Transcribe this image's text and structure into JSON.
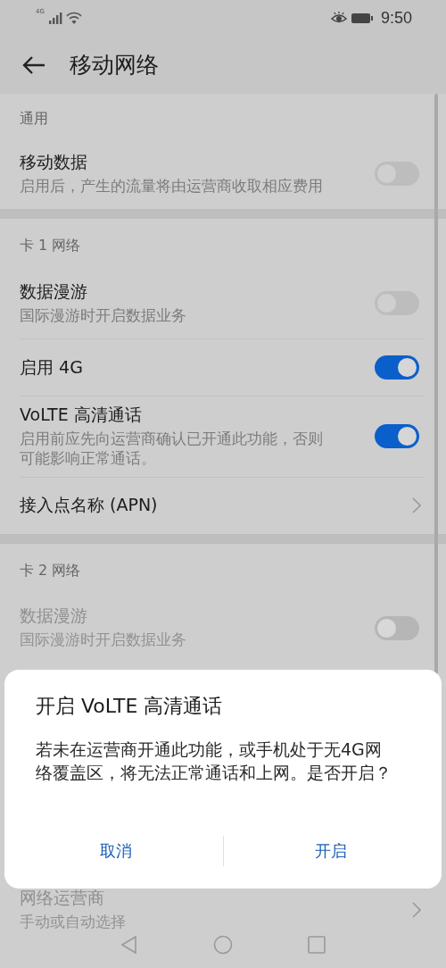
{
  "status_bar": {
    "network": "4G",
    "time": "9:50"
  },
  "header": {
    "title": "移动网络"
  },
  "sections": [
    {
      "label": "通用",
      "rows": [
        {
          "kind": "switch",
          "title": "移动数据",
          "subtitle": "启用后，产生的流量将由运营商收取相应费用",
          "on": false,
          "disabled": false
        }
      ]
    },
    {
      "label": "卡 1 网络",
      "rows": [
        {
          "kind": "switch",
          "title": "数据漫游",
          "subtitle": "国际漫游时开启数据业务",
          "on": false,
          "disabled": false
        },
        {
          "kind": "switch",
          "title": "启用 4G",
          "on": true,
          "disabled": false
        },
        {
          "kind": "switch",
          "title": "VoLTE 高清通话",
          "subtitle": "启用前应先向运营商确认已开通此功能，否则可能影响正常通话。",
          "on": true,
          "disabled": false
        },
        {
          "kind": "link",
          "title": "接入点名称 (APN)",
          "disabled": false
        }
      ]
    },
    {
      "label": "卡 2 网络",
      "rows": [
        {
          "kind": "switch",
          "title": "数据漫游",
          "subtitle": "国际漫游时开启数据业务",
          "on": false,
          "disabled": true
        },
        {
          "kind": "link",
          "title": "网络运营商",
          "subtitle": "手动或自动选择",
          "disabled": true
        }
      ]
    }
  ],
  "dialog": {
    "title": "开启 VoLTE 高清通话",
    "message": "若未在运营商开通此功能，或手机处于无4G网络覆盖区，将无法正常通话和上网。是否开启？",
    "buttons": [
      "取消",
      "开启"
    ]
  }
}
